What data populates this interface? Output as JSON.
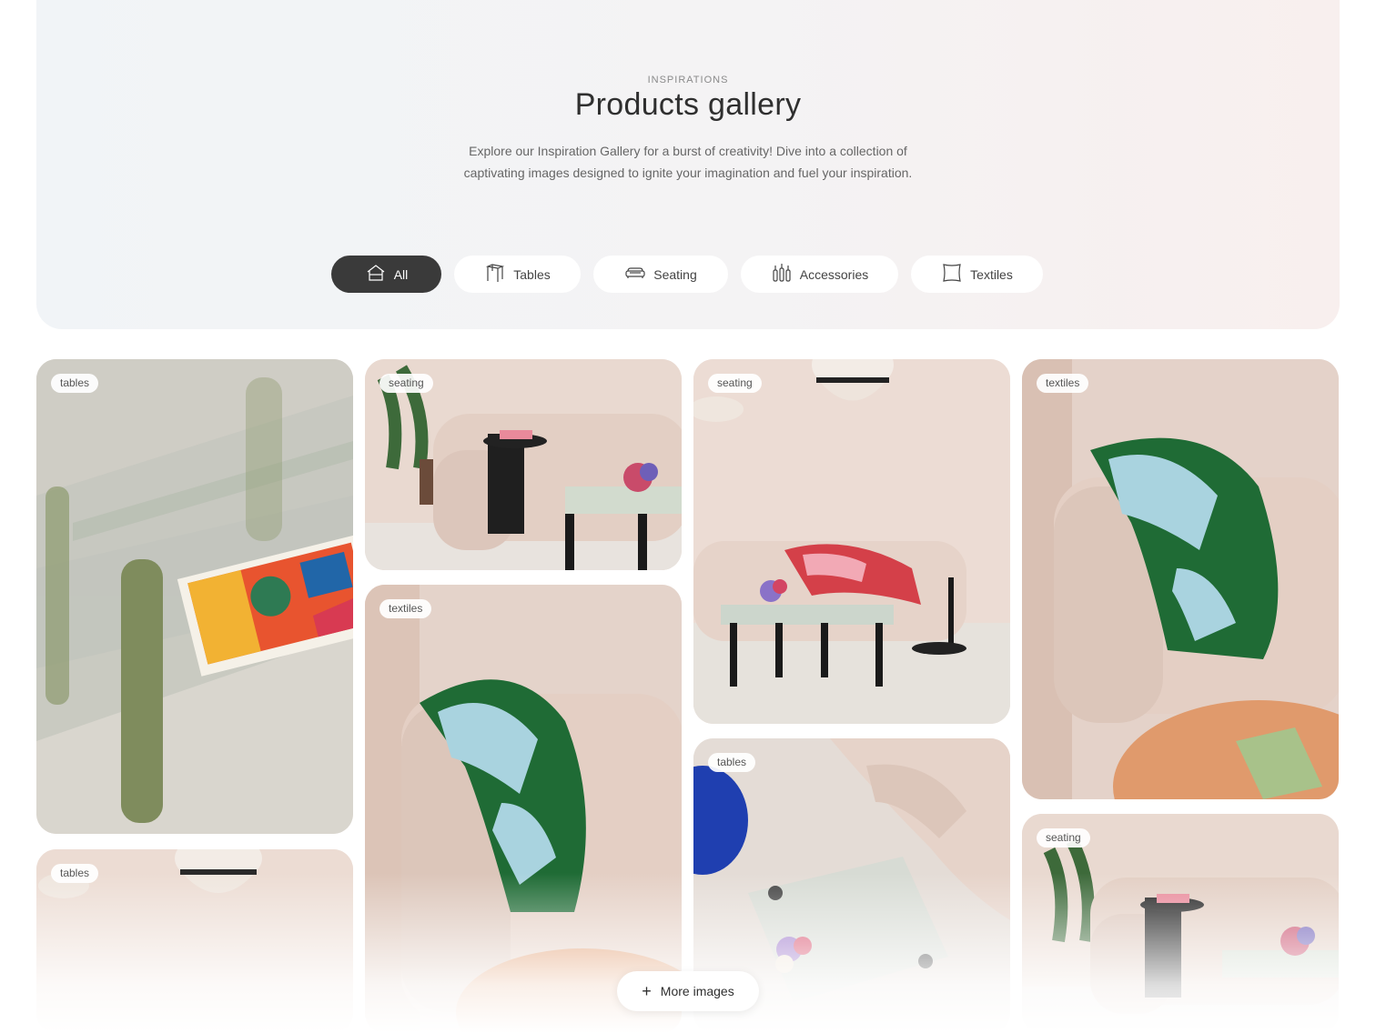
{
  "hero": {
    "eyebrow": "INSPIRATIONS",
    "title": "Products gallery",
    "description": "Explore our Inspiration Gallery for a burst of creativity! Dive into a collection of captivating images designed to ignite your imagination and fuel your inspiration."
  },
  "filters": [
    {
      "label": "All",
      "icon": "house-icon",
      "active": true
    },
    {
      "label": "Tables",
      "icon": "table-icon",
      "active": false
    },
    {
      "label": "Seating",
      "icon": "sofa-icon",
      "active": false
    },
    {
      "label": "Accessories",
      "icon": "vases-icon",
      "active": false
    },
    {
      "label": "Textiles",
      "icon": "cushion-icon",
      "active": false
    }
  ],
  "gallery": [
    {
      "tag": "tables"
    },
    {
      "tag": "tables"
    },
    {
      "tag": "seating"
    },
    {
      "tag": "textiles"
    },
    {
      "tag": "seating"
    },
    {
      "tag": "tables"
    },
    {
      "tag": "textiles"
    },
    {
      "tag": "seating"
    }
  ],
  "more_button": {
    "label": "More images",
    "icon": "plus-icon"
  },
  "colors": {
    "active_pill": "#3a3a3a",
    "sofa": "#e6d3c9",
    "wall": "#eadbd3",
    "throw_green": "#1f6b35",
    "throw_blue": "#a9d3df"
  }
}
